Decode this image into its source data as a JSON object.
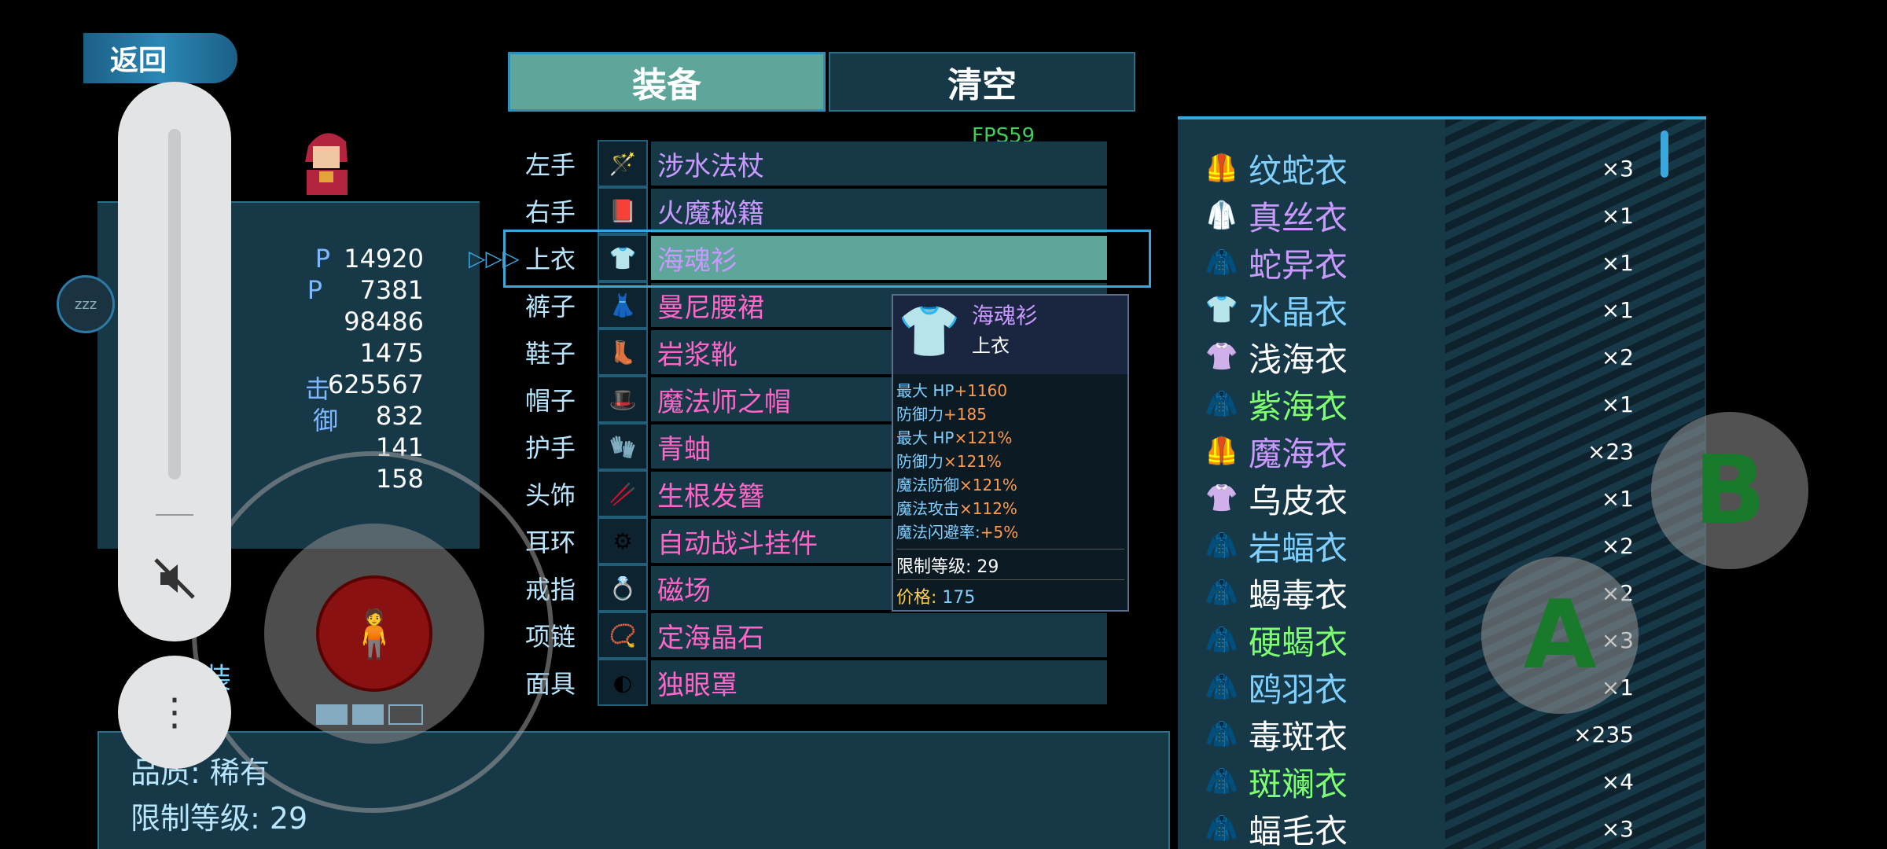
{
  "header": {
    "back_label": "返回"
  },
  "tabs": [
    {
      "label": "装备"
    },
    {
      "label": "清空"
    }
  ],
  "fps": "FPS59",
  "character": {
    "stats": [
      "14920",
      "7381",
      "98486",
      "1475",
      "625567",
      "832",
      "141",
      "158"
    ],
    "stat_label_fragments": [
      "P",
      "P",
      "",
      "",
      "击",
      "御",
      "",
      ""
    ]
  },
  "equipment_slots": [
    {
      "slot": "左手",
      "name": "涉水法杖",
      "icon": "staff-icon",
      "color": "purple"
    },
    {
      "slot": "右手",
      "name": "火魔秘籍",
      "icon": "book-icon",
      "color": "purple"
    },
    {
      "slot": "上衣",
      "name": "海魂衫",
      "icon": "armor-icon",
      "color": "purple"
    },
    {
      "slot": "裤子",
      "name": "曼尼腰裙",
      "icon": "skirt-icon",
      "color": "pink"
    },
    {
      "slot": "鞋子",
      "name": "岩浆靴",
      "icon": "boots-icon",
      "color": "pink"
    },
    {
      "slot": "帽子",
      "name": "魔法师之帽",
      "icon": "hat-icon",
      "color": "pink"
    },
    {
      "slot": "护手",
      "name": "青蚰",
      "icon": "glove-icon",
      "color": "pink"
    },
    {
      "slot": "头饰",
      "name": "生根发簪",
      "icon": "hairpin-icon",
      "color": "pink"
    },
    {
      "slot": "耳环",
      "name": "自动战斗挂件",
      "icon": "gear-icon",
      "color": "pink"
    },
    {
      "slot": "戒指",
      "name": "磁场",
      "icon": "ring-icon",
      "color": "pink"
    },
    {
      "slot": "项链",
      "name": "定海晶石",
      "icon": "necklace-icon",
      "color": "pink"
    },
    {
      "slot": "面具",
      "name": "独眼罩",
      "icon": "eyepatch-icon",
      "color": "pink"
    }
  ],
  "tooltip": {
    "name": "海魂衫",
    "type": "上衣",
    "lines": [
      {
        "label": "最大 HP",
        "value": "+1160"
      },
      {
        "label": "防御力",
        "value": "+185"
      },
      {
        "label": "最大 HP",
        "value": "×121%"
      },
      {
        "label": "防御力",
        "value": "×121%"
      },
      {
        "label": "魔法防御",
        "value": "×121%"
      },
      {
        "label": "魔法攻击",
        "value": "×112%"
      },
      {
        "label": "魔法闪避率:",
        "value": "+5%"
      }
    ],
    "level_label": "限制等级: 29",
    "price_label": "价格:",
    "price_value": "175"
  },
  "detail": {
    "quality": "品质: 稀有",
    "level": "限制等级: 29"
  },
  "side_tag": "装",
  "inventory": [
    {
      "name": "纹蛇衣",
      "count": "×3",
      "color": "blue"
    },
    {
      "name": "真丝衣",
      "count": "×1",
      "color": "purple"
    },
    {
      "name": "蛇异衣",
      "count": "×1",
      "color": "purple"
    },
    {
      "name": "水晶衣",
      "count": "×1",
      "color": "blue"
    },
    {
      "name": "浅海衣",
      "count": "×2",
      "color": "white"
    },
    {
      "name": "紫海衣",
      "count": "×1",
      "color": "green"
    },
    {
      "name": "魔海衣",
      "count": "×23",
      "color": "purple"
    },
    {
      "name": "乌皮衣",
      "count": "×1",
      "color": "white"
    },
    {
      "name": "岩蝠衣",
      "count": "×2",
      "color": "blue"
    },
    {
      "name": "蝎毒衣",
      "count": "×2",
      "color": "white"
    },
    {
      "name": "硬蝎衣",
      "count": "×3",
      "color": "green"
    },
    {
      "name": "鸥羽衣",
      "count": "×1",
      "color": "blue"
    },
    {
      "name": "毒斑衣",
      "count": "×235",
      "color": "white"
    },
    {
      "name": "斑斓衣",
      "count": "×4",
      "color": "green"
    },
    {
      "name": "蝠毛衣",
      "count": "×3",
      "color": "white"
    }
  ],
  "controls": {
    "a_label": "A",
    "b_label": "B",
    "sleep_label": "zzz"
  }
}
